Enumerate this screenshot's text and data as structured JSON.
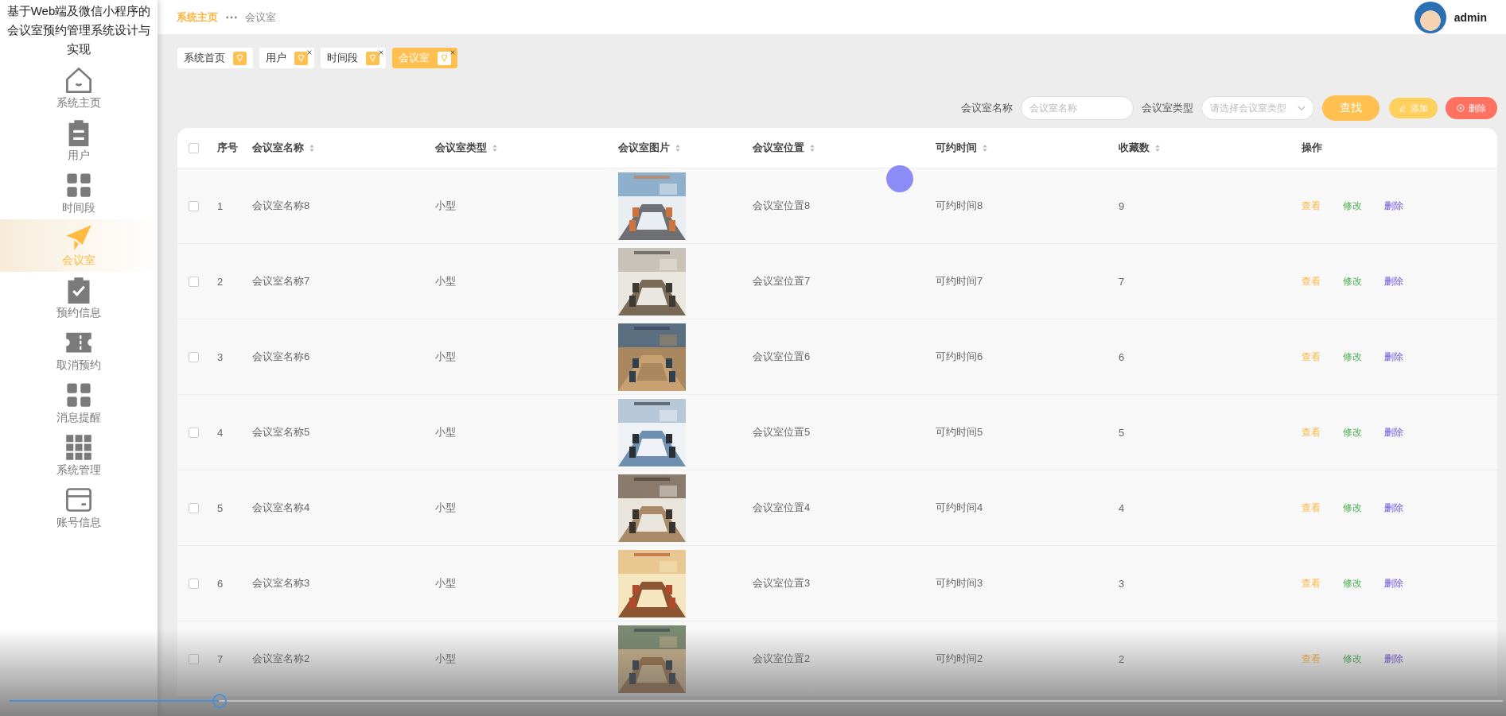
{
  "sidebar": {
    "title": "基于Web端及微信小程序的会议室预约管理系统设计与实现",
    "items": [
      {
        "label": "系统主页",
        "kind": "house",
        "selected": false
      },
      {
        "label": "用户",
        "kind": "clipboard",
        "selected": false
      },
      {
        "label": "时间段",
        "kind": "grid4",
        "selected": false
      },
      {
        "label": "会议室",
        "kind": "plane",
        "selected": true
      },
      {
        "label": "预约信息",
        "kind": "check",
        "selected": false
      },
      {
        "label": "取消预约",
        "kind": "ticket",
        "selected": false
      },
      {
        "label": "消息提醒",
        "kind": "grid4",
        "selected": false
      },
      {
        "label": "系统管理",
        "kind": "grid9",
        "selected": false
      },
      {
        "label": "账号信息",
        "kind": "card",
        "selected": false
      }
    ]
  },
  "breadcrumb": {
    "home": "系统主页",
    "current": "会议室"
  },
  "user": {
    "name": "admin"
  },
  "tags": [
    {
      "label": "系统首页",
      "closable": false,
      "selected": false
    },
    {
      "label": "用户",
      "closable": true,
      "selected": false
    },
    {
      "label": "时间段",
      "closable": true,
      "selected": false
    },
    {
      "label": "会议室",
      "closable": true,
      "selected": true
    }
  ],
  "search": {
    "name_label": "会议室名称",
    "name_placeholder": "会议室名称",
    "type_label": "会议室类型",
    "type_placeholder": "请选择会议室类型",
    "find": "查找",
    "add": "添加",
    "delete": "删除"
  },
  "table": {
    "select_all_checked": false,
    "columns": [
      "序号",
      "会议室名称",
      "会议室类型",
      "会议室图片",
      "会议室位置",
      "可约时间",
      "收藏数",
      "操作"
    ],
    "rows": [
      {
        "checked": false,
        "no": "1",
        "name": "会议室名称8",
        "type": "小型",
        "location": "会议室位置8",
        "time": "可约时间8",
        "favorites": "9",
        "picture": {
          "kind": "picture"
        },
        "actions": [
          "查看",
          "修改",
          "删除"
        ]
      },
      {
        "checked": false,
        "no": "2",
        "name": "会议室名称7",
        "type": "小型",
        "location": "会议室位置7",
        "time": "可约时间7",
        "favorites": "7",
        "picture": {
          "kind": "picture"
        },
        "actions": [
          "查看",
          "修改",
          "删除"
        ]
      },
      {
        "checked": false,
        "no": "3",
        "name": "会议室名称6",
        "type": "小型",
        "location": "会议室位置6",
        "time": "可约时间6",
        "favorites": "6",
        "picture": {
          "kind": "picture"
        },
        "actions": [
          "查看",
          "修改",
          "删除"
        ]
      },
      {
        "checked": false,
        "no": "4",
        "name": "会议室名称5",
        "type": "小型",
        "location": "会议室位置5",
        "time": "可约时间5",
        "favorites": "5",
        "picture": {
          "kind": "picture"
        },
        "actions": [
          "查看",
          "修改",
          "删除"
        ]
      },
      {
        "checked": false,
        "no": "5",
        "name": "会议室名称4",
        "type": "小型",
        "location": "会议室位置4",
        "time": "可约时间4",
        "favorites": "4",
        "picture": {
          "kind": "picture"
        },
        "actions": [
          "查看",
          "修改",
          "删除"
        ]
      },
      {
        "checked": false,
        "no": "6",
        "name": "会议室名称3",
        "type": "小型",
        "location": "会议室位置3",
        "time": "可约时间3",
        "favorites": "3",
        "picture": {
          "kind": "picture"
        },
        "actions": [
          "查看",
          "修改",
          "删除"
        ]
      },
      {
        "checked": false,
        "no": "7",
        "name": "会议室名称2",
        "type": "小型",
        "location": "会议室位置2",
        "time": "可约时间2",
        "favorites": "2",
        "picture": {
          "kind": "picture"
        },
        "actions": [
          "查看",
          "修改",
          "删除"
        ]
      }
    ]
  },
  "player": {
    "level": 0.14
  }
}
